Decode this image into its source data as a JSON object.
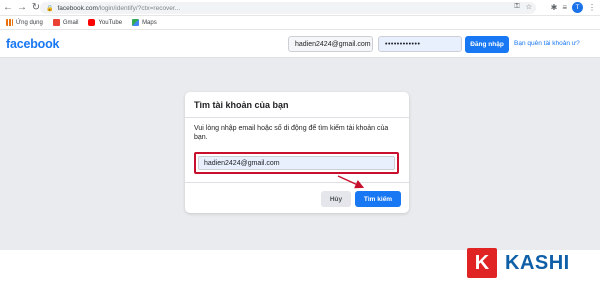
{
  "browser": {
    "url_host": "facebook.com",
    "url_path": "/login/identify/?ctx=recover...",
    "avatar_letter": "T"
  },
  "bookmarks": [
    {
      "label": "Ứng dụng",
      "icon": "apps-grid-icon",
      "color": "#e8710a"
    },
    {
      "label": "Gmail",
      "icon": "gmail-icon",
      "color": "#ea4335"
    },
    {
      "label": "YouTube",
      "icon": "youtube-icon",
      "color": "#ff0000"
    },
    {
      "label": "Maps",
      "icon": "maps-icon",
      "color": "#34a853"
    }
  ],
  "header": {
    "logo": "facebook",
    "email_value": "hadien2424@gmail.com",
    "password_mask": "••••••••••••",
    "login_label": "Đăng nhập",
    "forgot_label": "Bạn quên tài khoản ư?"
  },
  "card": {
    "title": "Tìm tài khoản của bạn",
    "description": "Vui lòng nhập email hoặc số di động để tìm kiếm tài khoản của bạn.",
    "input_value": "hadien2424@gmail.com",
    "cancel_label": "Hủy",
    "search_label": "Tìm kiếm"
  },
  "watermark": {
    "letter": "K",
    "text": "KASHI"
  },
  "colors": {
    "brand": "#1877f2",
    "highlight": "#c8102e",
    "watermark_red": "#e02424",
    "watermark_blue": "#0f5fa8"
  }
}
